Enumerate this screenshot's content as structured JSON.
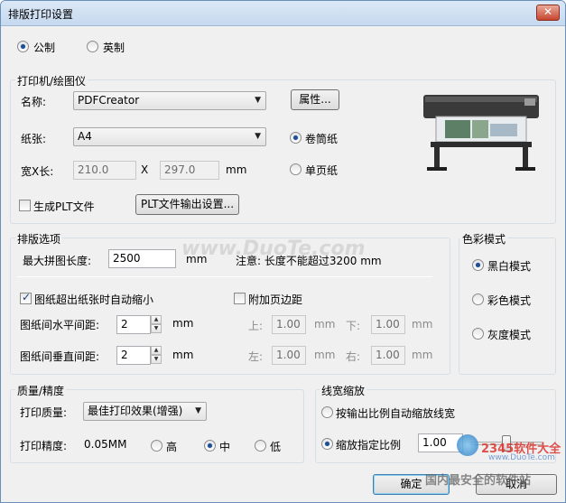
{
  "window": {
    "title": "排版打印设置",
    "close": "✕"
  },
  "units": {
    "metric": "公制",
    "imperial": "英制",
    "selected": "metric"
  },
  "printer_group": {
    "title": "打印机/绘图仪",
    "name_label": "名称:",
    "name_value": "PDFCreator",
    "properties_button": "属性...",
    "paper_label": "纸张:",
    "paper_value": "A4",
    "roll_paper": "卷筒纸",
    "single_sheet": "单页纸",
    "paper_mode": "roll",
    "width_label": "宽X长:",
    "width_value": "210.0",
    "times": "X",
    "length_value": "297.0",
    "size_unit": "mm",
    "gen_plt_label": "生成PLT文件",
    "gen_plt_checked": false,
    "plt_settings_button": "PLT文件输出设置..."
  },
  "layout_group": {
    "title": "排版选项",
    "max_length_label": "最大拼图长度:",
    "max_length_value": "2500",
    "max_length_unit": "mm",
    "note": "注意: 长度不能超过3200 mm",
    "auto_shrink_label": "图纸超出纸张时自动缩小",
    "auto_shrink_checked": true,
    "add_margin_label": "附加页边距",
    "add_margin_checked": false,
    "h_gap_label": "图纸间水平间距:",
    "h_gap_value": "2",
    "v_gap_label": "图纸间垂直间距:",
    "v_gap_value": "2",
    "gap_unit": "mm",
    "margin_top_label": "上:",
    "margin_top": "1.00",
    "margin_bottom_label": "下:",
    "margin_bottom": "1.00",
    "margin_left_label": "左:",
    "margin_left": "1.00",
    "margin_right_label": "右:",
    "margin_right": "1.00",
    "margin_unit": "mm"
  },
  "color_group": {
    "title": "色彩模式",
    "options": [
      "黑白模式",
      "彩色模式",
      "灰度模式"
    ],
    "selected": "黑白模式"
  },
  "quality_group": {
    "title": "质量/精度",
    "quality_label": "打印质量:",
    "quality_value": "最佳打印效果(增强)",
    "precision_label": "打印精度:",
    "precision_value": "0.05MM",
    "levels": [
      "高",
      "中",
      "低"
    ],
    "selected_level": "中"
  },
  "linewidth_group": {
    "title": "线宽缩放",
    "auto_option": "按输出比例自动缩放线宽",
    "scale_option": "缩放指定比例",
    "selected": "scale",
    "scale_value": "1.00",
    "scale_fraction": 0.5
  },
  "buttons": {
    "ok": "确定",
    "cancel": "取消"
  },
  "watermark": {
    "mid": "www.DuoTe.com",
    "site": "2345软件大全",
    "url": "www.DuoTe.com",
    "slogan": "国内最安全的软件站"
  },
  "colors": {
    "accent": "#1d4f91",
    "title_bg": "#c6d9ef",
    "dialog_bg": "#f0f0f0"
  }
}
